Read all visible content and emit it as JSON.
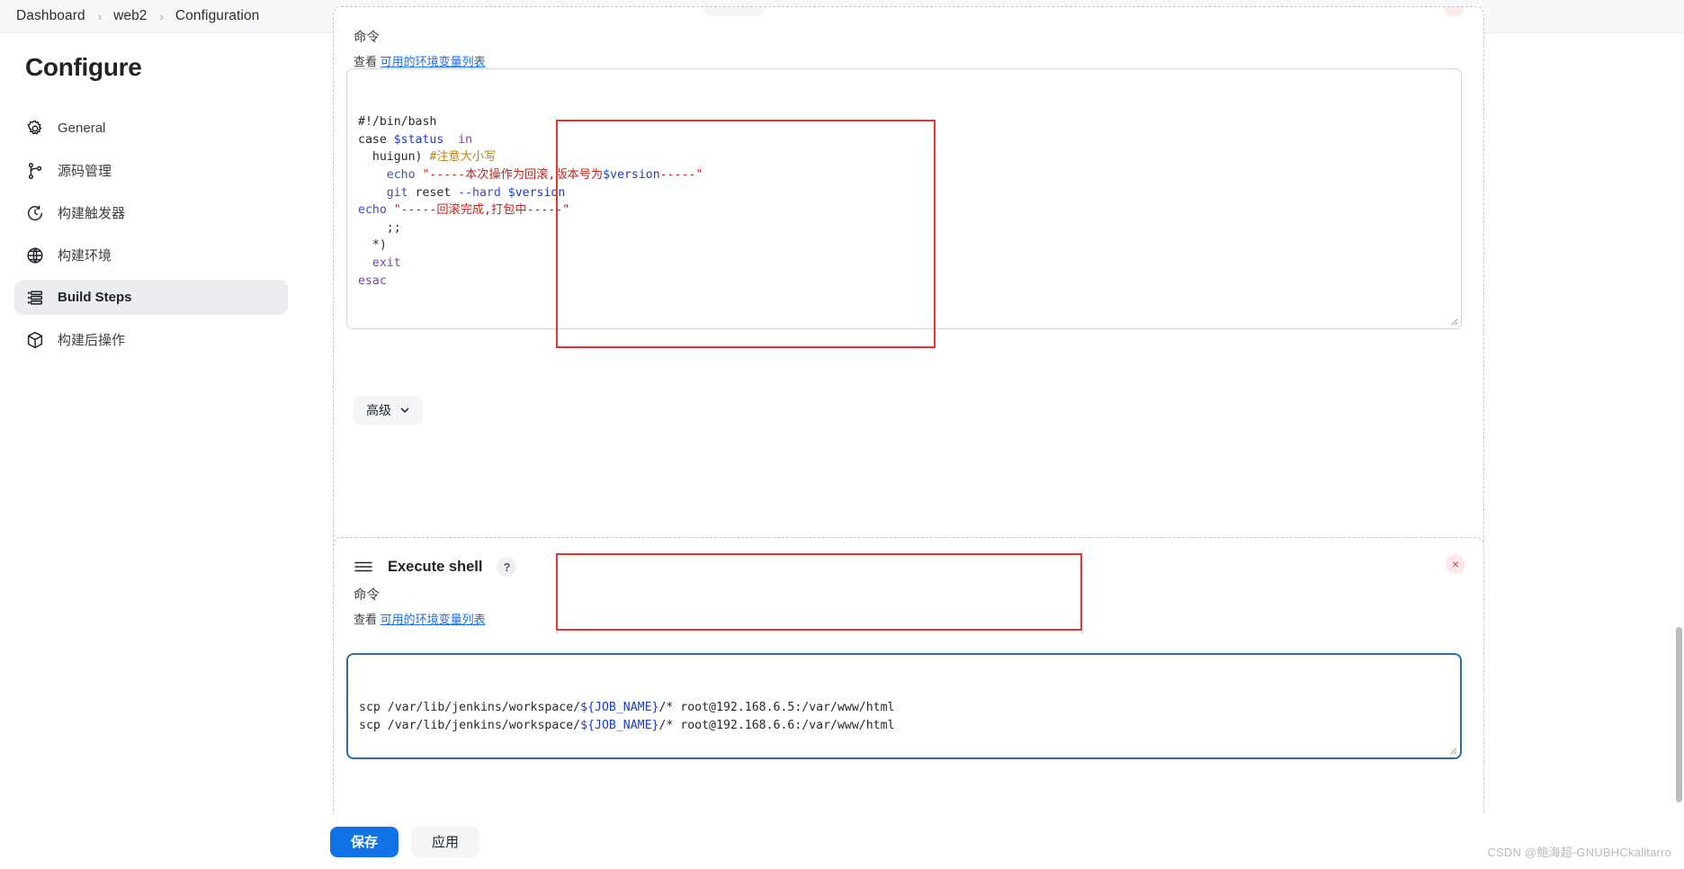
{
  "breadcrumb": {
    "items": [
      "Dashboard",
      "web2",
      "Configuration"
    ],
    "separator": "›"
  },
  "sidebar": {
    "title": "Configure",
    "items": [
      {
        "label": "General",
        "icon": "gear-icon",
        "active": false
      },
      {
        "label": "源码管理",
        "icon": "git-branch-icon",
        "active": false
      },
      {
        "label": "构建触发器",
        "icon": "clock-icon",
        "active": false
      },
      {
        "label": "构建环境",
        "icon": "globe-icon",
        "active": false
      },
      {
        "label": "Build Steps",
        "icon": "list-icon",
        "active": true
      },
      {
        "label": "构建后操作",
        "icon": "package-icon",
        "active": false
      }
    ]
  },
  "steps": [
    {
      "title": "",
      "command_label": "命令",
      "env_prefix": "查看",
      "env_link": "可用的环境变量列表",
      "advanced_label": "高级",
      "script_lines": [
        [
          {
            "t": "#!/bin/bash",
            "c": "tok-plain"
          }
        ],
        [
          {
            "t": "case ",
            "c": "tok-plain"
          },
          {
            "t": "$status",
            "c": "tok-var"
          },
          {
            "t": "  ",
            "c": "tok-plain"
          },
          {
            "t": "in",
            "c": "tok-kw"
          }
        ],
        [
          {
            "t": "  huigun) ",
            "c": "tok-plain"
          },
          {
            "t": "#注意大小写",
            "c": "tok-cmt"
          }
        ],
        [
          {
            "t": "    ",
            "c": "tok-plain"
          },
          {
            "t": "echo",
            "c": "tok-cmd"
          },
          {
            "t": " ",
            "c": "tok-plain"
          },
          {
            "t": "\"-----本次操作为回滚,版本号为",
            "c": "tok-str"
          },
          {
            "t": "$version",
            "c": "tok-var"
          },
          {
            "t": "-----\"",
            "c": "tok-str"
          }
        ],
        [
          {
            "t": "    ",
            "c": "tok-plain"
          },
          {
            "t": "git",
            "c": "tok-cmd"
          },
          {
            "t": " reset ",
            "c": "tok-plain"
          },
          {
            "t": "--hard",
            "c": "tok-cmd"
          },
          {
            "t": " ",
            "c": "tok-plain"
          },
          {
            "t": "$version",
            "c": "tok-var"
          }
        ],
        [
          {
            "t": "echo",
            "c": "tok-cmd"
          },
          {
            "t": " ",
            "c": "tok-plain"
          },
          {
            "t": "\"-----回滚完成,打包中-----\"",
            "c": "tok-str"
          }
        ],
        [
          {
            "t": "    ;;",
            "c": "tok-plain"
          }
        ],
        [
          {
            "t": "  *)",
            "c": "tok-plain"
          }
        ],
        [
          {
            "t": "  ",
            "c": "tok-plain"
          },
          {
            "t": "exit",
            "c": "tok-kw"
          }
        ],
        [
          {
            "t": "esac",
            "c": "tok-kw"
          }
        ]
      ]
    },
    {
      "title": "Execute shell",
      "help": "?",
      "command_label": "命令",
      "env_prefix": "查看",
      "env_link": "可用的环境变量列表",
      "close": "×",
      "script_lines": [
        [
          {
            "t": "scp /var/lib/jenkins/workspace/",
            "c": "tok-plain"
          },
          {
            "t": "${JOB_NAME}",
            "c": "tok-var"
          },
          {
            "t": "/* root@192.168.6.5:/var/www/html",
            "c": "tok-plain"
          }
        ],
        [
          {
            "t": "scp /var/lib/jenkins/workspace/",
            "c": "tok-plain"
          },
          {
            "t": "${JOB_NAME}",
            "c": "tok-var"
          },
          {
            "t": "/* root@192.168.6.6:/var/www/html",
            "c": "tok-plain"
          }
        ]
      ]
    }
  ],
  "actions": {
    "save_label": "保存",
    "apply_label": "应用"
  },
  "watermark": "CSDN @鲍海超-GNUBHCkalitarro",
  "colors": {
    "primary": "#1273e6",
    "annotation": "#e8352c",
    "link": "#1d6ee8",
    "focus_border": "#2e6da4"
  }
}
